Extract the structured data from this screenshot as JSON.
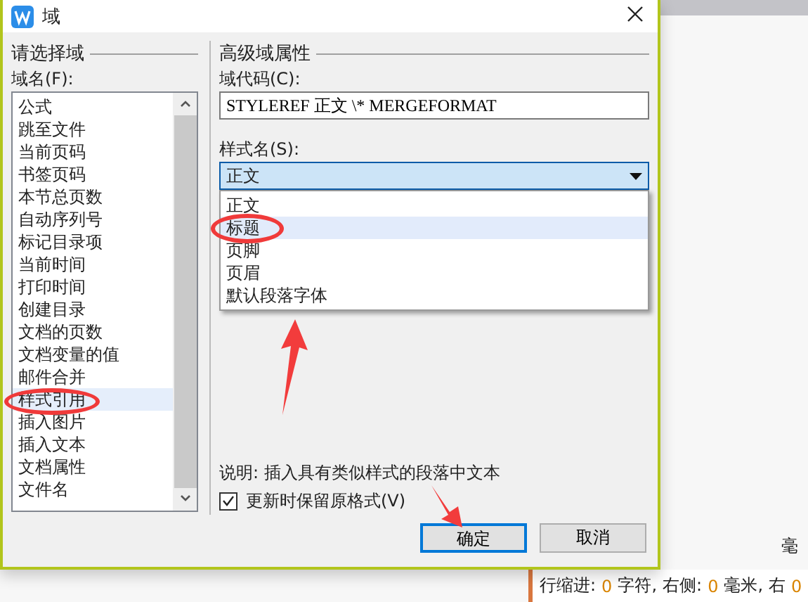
{
  "window": {
    "title": "域"
  },
  "field_list": {
    "heading": "请选择域",
    "label": "域名(F):",
    "items": [
      {
        "label": "公式",
        "selected": false
      },
      {
        "label": "跳至文件",
        "selected": false
      },
      {
        "label": "当前页码",
        "selected": false
      },
      {
        "label": "书签页码",
        "selected": false
      },
      {
        "label": "本节总页数",
        "selected": false
      },
      {
        "label": "自动序列号",
        "selected": false
      },
      {
        "label": "标记目录项",
        "selected": false
      },
      {
        "label": "当前时间",
        "selected": false
      },
      {
        "label": "打印时间",
        "selected": false
      },
      {
        "label": "创建目录",
        "selected": false
      },
      {
        "label": "文档的页数",
        "selected": false
      },
      {
        "label": "文档变量的值",
        "selected": false
      },
      {
        "label": "邮件合并",
        "selected": false
      },
      {
        "label": "样式引用",
        "selected": true
      },
      {
        "label": "插入图片",
        "selected": false
      },
      {
        "label": "插入文本",
        "selected": false
      },
      {
        "label": "文档属性",
        "selected": false
      },
      {
        "label": "文件名",
        "selected": false
      }
    ]
  },
  "properties": {
    "heading": "高级域属性",
    "code_label": "域代码(C):",
    "code_value": "STYLEREF 正文 \\* MERGEFORMAT",
    "style_label": "样式名(S):",
    "style_value": "正文",
    "style_options": [
      {
        "label": "正文",
        "selected": false
      },
      {
        "label": "标题",
        "selected": true
      },
      {
        "label": "页脚",
        "selected": false
      },
      {
        "label": "页眉",
        "selected": false
      },
      {
        "label": "默认段落字体",
        "selected": false
      }
    ],
    "description": "说明: 插入具有类似样式的段落中文本",
    "keep_format": {
      "label": "更新时保留原格式(V)",
      "checked": true
    }
  },
  "buttons": [
    {
      "label": "确定",
      "default": true
    },
    {
      "label": "取消",
      "default": false
    }
  ],
  "document": {
    "side_text": "毫",
    "status": [
      {
        "text": "行缩进:",
        "kind": "label"
      },
      {
        "text": "0",
        "kind": "value"
      },
      {
        "text": "字符,",
        "kind": "label"
      },
      {
        "text": "右侧:",
        "kind": "label"
      },
      {
        "text": "0",
        "kind": "value"
      },
      {
        "text": "毫米,",
        "kind": "label"
      },
      {
        "text": "右",
        "kind": "label"
      },
      {
        "text": "0",
        "kind": "value"
      }
    ]
  }
}
